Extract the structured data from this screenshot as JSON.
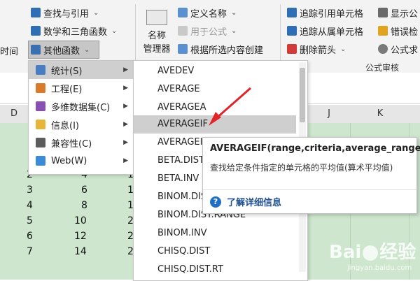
{
  "ribbon": {
    "time_fragment": "时间",
    "lookup_ref": "查找与引用",
    "math_trig": "数学和三角函数",
    "more_functions": "其他函数",
    "name_manager_line1": "名称",
    "name_manager_line2": "管理器",
    "define_name": "定义名称",
    "use_in_formula": "用于公式",
    "create_from_selection": "根据所选内容创建",
    "trace_precedents": "追踪引用单元格",
    "trace_dependents": "追踪从属单元格",
    "remove_arrows": "删除箭头",
    "show_formulas": "显示公",
    "error_checking": "错误检",
    "evaluate_formula": "公式求",
    "group_formula_audit": "公式审核"
  },
  "columns": {
    "d": "D",
    "j": "J",
    "k": "K"
  },
  "cells": {
    "d": [
      "2",
      "3",
      "4",
      "5",
      "6",
      "7"
    ],
    "e": [
      "4",
      "6",
      "8",
      "10",
      "12",
      "14"
    ],
    "f": [
      "1",
      "1",
      "1",
      "2",
      "2",
      "2"
    ]
  },
  "menu1": {
    "items": [
      {
        "label": "统计(S)",
        "icon": "statistics-icon"
      },
      {
        "label": "工程(E)",
        "icon": "engineering-icon"
      },
      {
        "label": "多维数据集(C)",
        "icon": "cube-icon"
      },
      {
        "label": "信息(I)",
        "icon": "info-icon"
      },
      {
        "label": "兼容性(C)",
        "icon": "compatibility-icon"
      },
      {
        "label": "Web(W)",
        "icon": "web-icon"
      }
    ]
  },
  "menu2": {
    "items": [
      "AVEDEV",
      "AVERAGE",
      "AVERAGEA",
      "AVERAGEIF",
      "AVERAGEIFS",
      "BETA.DIST",
      "BETA.INV",
      "BINOM.DIST",
      "BINOM.DIST.RANGE",
      "BINOM.INV",
      "CHISQ.DIST",
      "CHISQ.DIST.RT"
    ]
  },
  "tooltip": {
    "signature": "AVERAGEIF(range,criteria,average_range)",
    "description": "查找给定条件指定的单元格的平均值(算术平均值)",
    "help_link": "了解详细信息"
  },
  "watermark": {
    "brand": "Bai",
    "brand2": "经验",
    "url": "jingyan.baidu.com"
  },
  "colors": {
    "selected_green": "#cde6cd",
    "highlight": "#cfcfcf",
    "arrow_red": "#e0262b",
    "help_blue": "#1f6fc5"
  }
}
